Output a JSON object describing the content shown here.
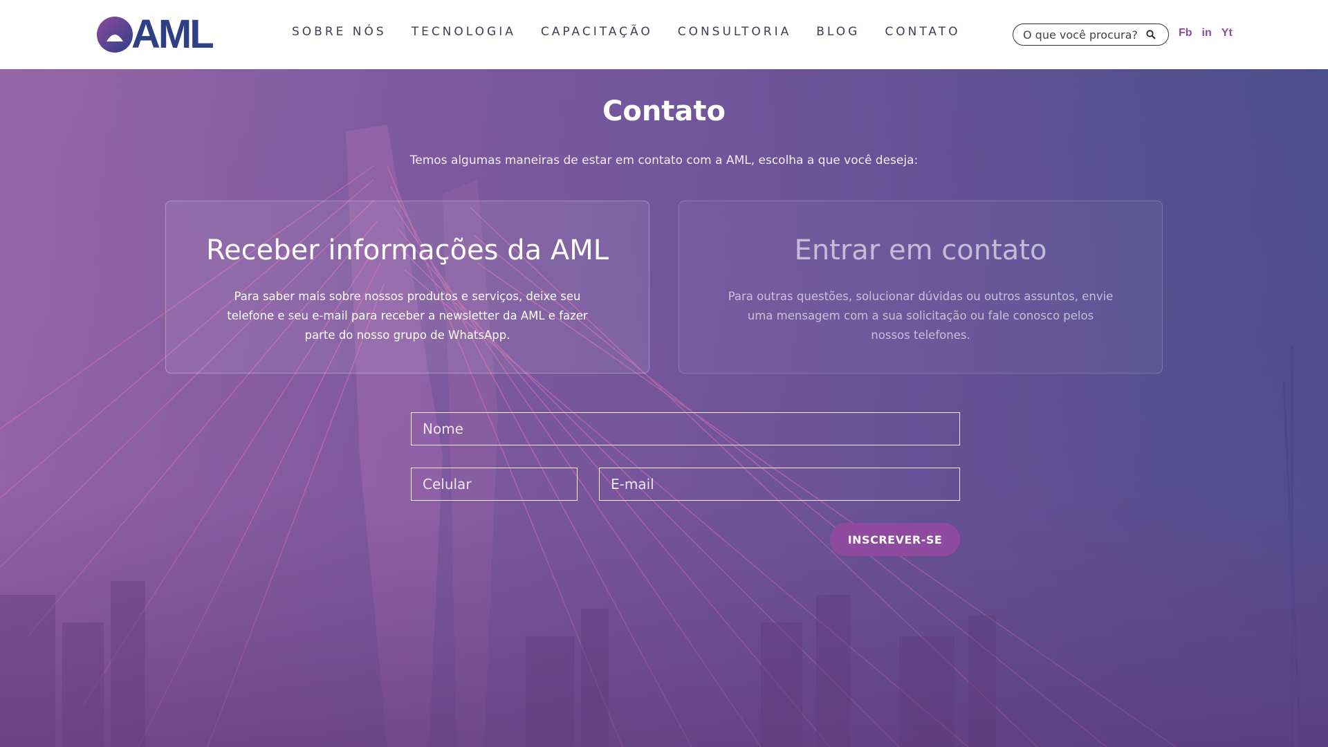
{
  "brand": {
    "logo_text": "AML",
    "accent": "#8e4a9e",
    "logo_color": "#2f3f86"
  },
  "nav": {
    "items": [
      {
        "label": "SOBRE NÓS"
      },
      {
        "label": "TECNOLOGIA"
      },
      {
        "label": "CAPACITAÇÃO"
      },
      {
        "label": "CONSULTORIA"
      },
      {
        "label": "BLOG"
      },
      {
        "label": "CONTATO"
      }
    ]
  },
  "search": {
    "placeholder": "O que você procura?",
    "icon": "search-icon"
  },
  "socials": [
    {
      "label": "Fb"
    },
    {
      "label": "in"
    },
    {
      "label": "Yt"
    }
  ],
  "hero": {
    "title": "Contato",
    "subtitle": "Temos algumas maneiras de estar em contato com a AML, escolha a que você deseja:",
    "cards": [
      {
        "title": "Receber informações da AML",
        "text": "Para saber mais sobre nossos produtos e serviços, deixe seu telefone e seu e-mail para receber a newsletter da AML e fazer parte do nosso grupo de WhatsApp."
      },
      {
        "title": "Entrar em contato",
        "text": "Para outras questões, solucionar dúvidas ou outros assuntos, envie uma mensagem com a sua solicitação ou fale conosco pelos nossos telefones."
      }
    ]
  },
  "form": {
    "name_placeholder": "Nome",
    "phone_placeholder": "Celular",
    "email_placeholder": "E-mail",
    "submit_label": "INSCREVER-SE"
  }
}
